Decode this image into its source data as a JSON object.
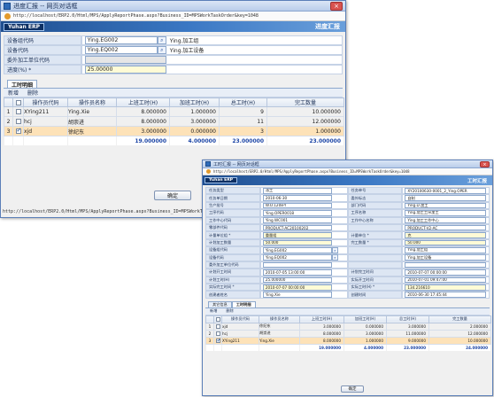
{
  "window1": {
    "title": "进度汇报 -- 网页对话框",
    "close_glyph": "×",
    "url": "http://localhost/ERP2.0/Html/MPS/ApplyReportPhase.aspx?Business_ID=MPSWorkTaskOrder&key=1048",
    "logo": "Yuhan ERP",
    "page_title": "进度汇报",
    "form": [
      {
        "label": "设备组代码",
        "value": "Ying.EG002",
        "desc": "Ying.加工组"
      },
      {
        "label": "设备代码",
        "value": "Ying.EQ002",
        "desc": "Ying.加工设备"
      },
      {
        "label": "委外加工单位代码",
        "value": "",
        "desc": ""
      },
      {
        "label": "进度(%) *",
        "value": "25.00000",
        "desc": ""
      }
    ],
    "tab_label": "工时明细",
    "toolbar": {
      "add": "新增",
      "delete": "删除"
    },
    "columns": [
      "",
      "",
      "操作员代码",
      "操作员名称",
      "上班工时(H)",
      "加班工时(H)",
      "总工时(H)",
      "完工数量"
    ],
    "rows": [
      {
        "no": "1",
        "code": "XYing211",
        "name": "Ying.Xie",
        "regular": "8.000000",
        "overtime": "1.000000",
        "total": "9",
        "qty": "10.000000",
        "checked": false
      },
      {
        "no": "2",
        "code": "hcj",
        "name": "胡崇进",
        "regular": "8.000000",
        "overtime": "3.000000",
        "total": "11",
        "qty": "12.000000",
        "checked": false
      },
      {
        "no": "3",
        "code": "xjd",
        "name": "徐纪东",
        "regular": "3.000000",
        "overtime": "0.000000",
        "total": "3",
        "qty": "1.000000",
        "checked": true
      }
    ],
    "totals": {
      "regular": "19.000000",
      "overtime": "4.000000",
      "total": "23.000000",
      "qty": "23.000000"
    },
    "ok_label": "确定",
    "status_url": "http://localhost/ERP2.0/Html/MPS/ApplyReportPhase.aspx?Business_ID=MPSWorkTaskOrder&key=1048"
  },
  "window2": {
    "title": "工时汇报 -- 网页对话框",
    "close_glyph": "×",
    "url": "http://localhost/ERP2.0/Html/MPS/ApplyReportPhase.aspx?Business_ID=MPSWorkTaskOrder&key=1048",
    "logo": "Yuhan ERP",
    "page_title": "工时汇报",
    "form": [
      {
        "l1": "任务类型",
        "v1": "派工",
        "l2": "任务单号",
        "v2": "XY20100630-0001_2_Ying.OPER"
      },
      {
        "l1": "任务单日期",
        "v1": "2010-06-30",
        "l2": "委外标志",
        "v2": "自制"
      },
      {
        "l1": "生产批号",
        "v1": "W.O.1208-Y",
        "l2": "部门代码",
        "v2": "Ying.D.加工"
      },
      {
        "l1": "工序代码",
        "v1": "Ying.OPER0018",
        "l2": "工序名称",
        "v2": "Ying.加工工序加工"
      },
      {
        "l1": "工作中心代码",
        "v1": "Ying.WC001",
        "l2": "工作中心名称",
        "v2": "Ying.加工工作中心"
      },
      {
        "l1": "零部件代码",
        "v1": "PRODUCT-AC20100202",
        "l2": "",
        "v2": "PRODUCT-V2-AC"
      },
      {
        "l1": "计量单位组 *",
        "v1": "重量组",
        "l2": "计量单位 *",
        "v2": "克"
      },
      {
        "l1": "计划加工数量",
        "v1": "50.000",
        "l2": "完工数量 *",
        "v2": "50.000"
      },
      {
        "l1": "设备组代码",
        "v1": "Ying.EG002",
        "l2": "",
        "v2": "Ying.加工组"
      },
      {
        "l1": "设备代码",
        "v1": "Ying.EQ002",
        "l2": "",
        "v2": "Ying.加工设备"
      },
      {
        "l1": "委外加工单位代码",
        "v1": "",
        "l2": "",
        "v2": ""
      },
      {
        "l1": "计划开工时间",
        "v1": "2010-07-05 13:00:00",
        "l2": "计划完工时间",
        "v2": "2010-07-07 00:00:00"
      },
      {
        "l1": "计划工时(H)",
        "v1": "25.000000",
        "l2": "实际开工时间",
        "v2": "2010-07-01 09:47:00"
      },
      {
        "l1": "实际完工时间 *",
        "v1": "2010-07-07 00:00:00",
        "l2": "实际工时(H) *",
        "v2": "134.216610"
      },
      {
        "l1": "创建者姓名",
        "v1": "Ying.Xie",
        "l2": "创建时间",
        "v2": "2010-06-30 17:45:44"
      }
    ],
    "tabs": [
      "其它信息",
      "工时明细"
    ],
    "toolbar": {
      "add": "新增",
      "delete": "删除"
    },
    "columns": [
      "",
      "",
      "操作员代码",
      "操作员名称",
      "上班工时(H)",
      "加班工时(H)",
      "总工时(H)",
      "完工数量"
    ],
    "rows": [
      {
        "no": "1",
        "code": "xjd",
        "name": "徐纪东",
        "regular": "3.000000",
        "overtime": "0.000000",
        "total": "3.000000",
        "qty": "2.000000",
        "checked": false
      },
      {
        "no": "2",
        "code": "hcj",
        "name": "胡崇进",
        "regular": "8.000000",
        "overtime": "3.000000",
        "total": "11.000000",
        "qty": "12.000000",
        "checked": false
      },
      {
        "no": "3",
        "code": "XYing211",
        "name": "Ying.Xie",
        "regular": "8.000000",
        "overtime": "1.000000",
        "total": "9.000000",
        "qty": "10.000000",
        "checked": true
      }
    ],
    "totals": {
      "regular": "19.000000",
      "overtime": "4.000000",
      "total": "23.000000",
      "qty": "24.000000"
    },
    "ok_label": "确定"
  }
}
